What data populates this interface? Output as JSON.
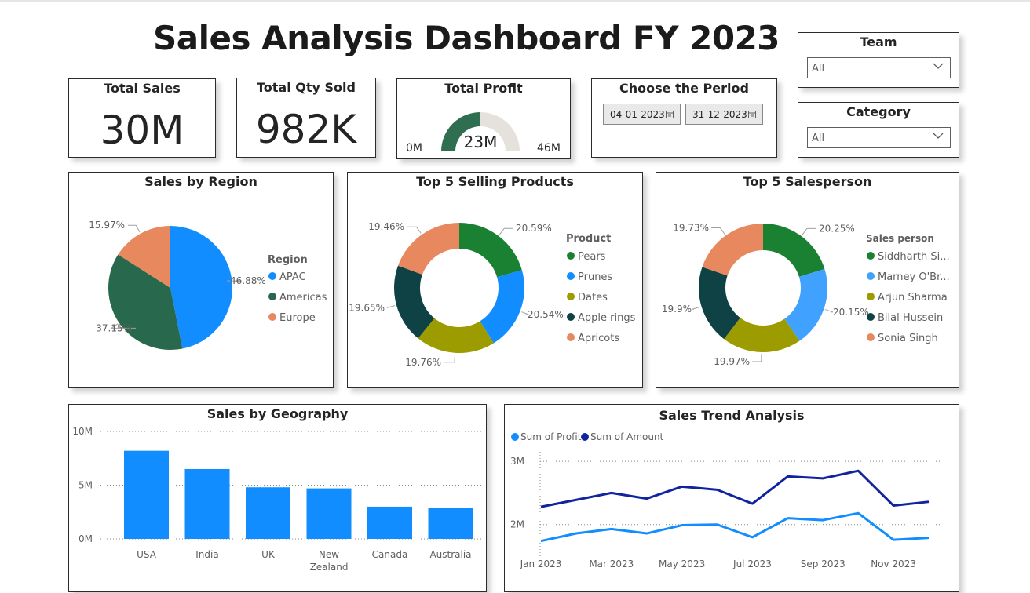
{
  "title": "Sales Analysis Dashboard FY 2023",
  "kpis": {
    "total_sales": {
      "label": "Total Sales",
      "value": "30M"
    },
    "total_qty": {
      "label": "Total Qty Sold",
      "value": "982K"
    },
    "total_profit": {
      "label": "Total Profit",
      "value": "23M",
      "min": "0M",
      "max": "46M",
      "fill_fraction": 0.5
    }
  },
  "period": {
    "label": "Choose the Period",
    "start": "04-01-2023",
    "end": "31-12-2023"
  },
  "team_slicer": {
    "label": "Team",
    "value": "All"
  },
  "category_slicer": {
    "label": "Category",
    "value": "All"
  },
  "colors": {
    "blue": "#118DFF",
    "dark_green": "#28694E",
    "orange": "#E8885F",
    "green": "#1A8032",
    "olive": "#9C9C00",
    "dark_teal": "#0E4245",
    "light_blue": "#40A1FF",
    "navy": "#12239E",
    "gauge_fill": "#2F6E50",
    "gauge_bg": "#E5E1DD"
  },
  "chart_data": [
    {
      "type": "pie",
      "title": "Sales by Region",
      "legend_title": "Region",
      "categories": [
        "APAC",
        "Americas",
        "Europe"
      ],
      "values": [
        46.88,
        37.15,
        15.97
      ],
      "labels": [
        "46.88%",
        "37.15%",
        "15.97%"
      ]
    },
    {
      "type": "pie",
      "subtype": "donut",
      "title": "Top 5 Selling Products",
      "legend_title": "Product",
      "categories": [
        "Pears",
        "Prunes",
        "Dates",
        "Apple rings",
        "Apricots"
      ],
      "values": [
        20.59,
        20.54,
        19.76,
        19.65,
        19.46
      ],
      "labels": [
        "20.59%",
        "20.54%",
        "19.76%",
        "19.65%",
        "19.46%"
      ]
    },
    {
      "type": "pie",
      "subtype": "donut",
      "title": "Top 5 Salesperson",
      "legend_title": "Sales person",
      "categories": [
        "Siddharth Si...",
        "Marney O'Br...",
        "Arjun Sharma",
        "Bilal Hussein",
        "Sonia Singh"
      ],
      "values": [
        20.25,
        20.15,
        19.97,
        19.9,
        19.73
      ],
      "labels": [
        "20.25%",
        "20.15%",
        "19.97%",
        "19.9%",
        "19.73%"
      ]
    },
    {
      "type": "bar",
      "title": "Sales by Geography",
      "categories": [
        "USA",
        "India",
        "UK",
        "New Zealand",
        "Canada",
        "Australia"
      ],
      "values": [
        8.2,
        6.5,
        4.8,
        4.7,
        3.0,
        2.9
      ],
      "unit": "M",
      "yticks": [
        "0M",
        "5M",
        "10M"
      ],
      "ylim": [
        0,
        10
      ],
      "grid": true
    },
    {
      "type": "line",
      "title": "Sales Trend Analysis",
      "x": [
        "Jan 2023",
        "Feb 2023",
        "Mar 2023",
        "Apr 2023",
        "May 2023",
        "Jun 2023",
        "Jul 2023",
        "Aug 2023",
        "Sep 2023",
        "Oct 2023",
        "Nov 2023",
        "Dec 2023"
      ],
      "xticks": [
        "Jan 2023",
        "Mar 2023",
        "May 2023",
        "Jul 2023",
        "Sep 2023",
        "Nov 2023"
      ],
      "series": [
        {
          "name": "Sum of Profit",
          "values": [
            1.74,
            1.86,
            1.93,
            1.86,
            1.99,
            2.0,
            1.8,
            2.1,
            2.07,
            2.18,
            1.76,
            1.79
          ]
        },
        {
          "name": "Sum of Amount",
          "values": [
            2.28,
            2.39,
            2.5,
            2.41,
            2.6,
            2.55,
            2.33,
            2.76,
            2.73,
            2.85,
            2.3,
            2.36
          ]
        }
      ],
      "yticks": [
        "2M",
        "3M"
      ],
      "ylim": [
        1.6,
        3.1
      ],
      "legend": "top-left",
      "grid": true
    }
  ]
}
